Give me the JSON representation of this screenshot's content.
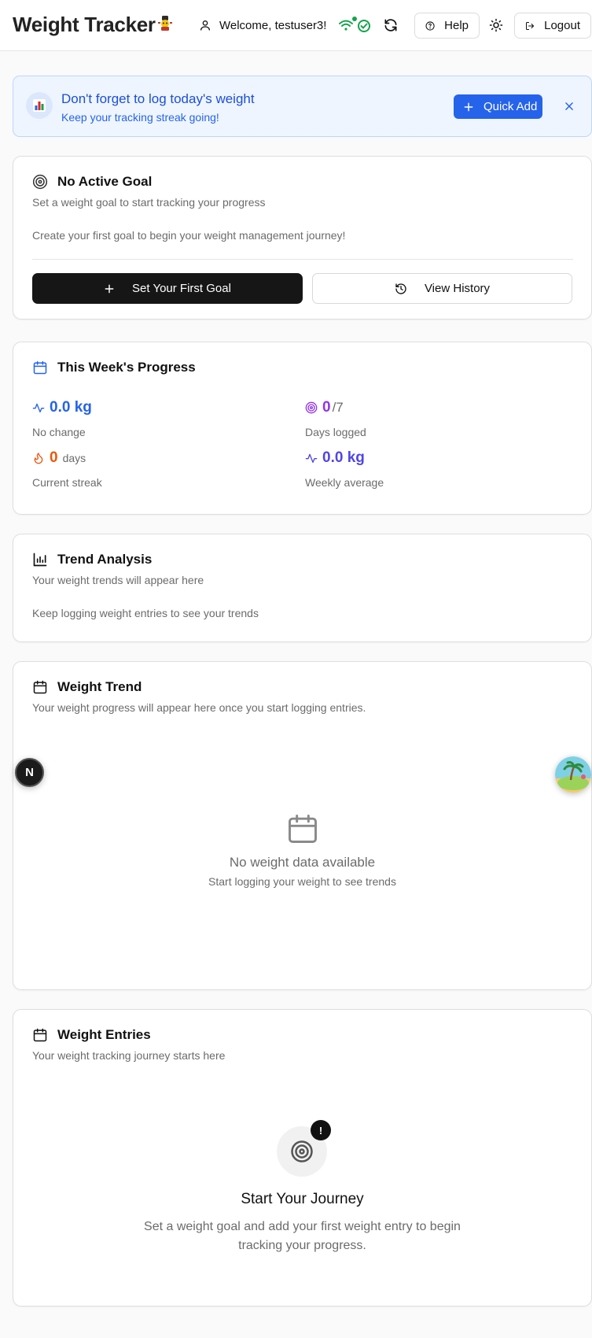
{
  "header": {
    "title": "Weight Tracker",
    "welcome": "Welcome, testuser3!",
    "help_label": "Help",
    "logout_label": "Logout"
  },
  "banner": {
    "title": "Don't forget to log today's weight",
    "subtitle": "Keep your tracking streak going!",
    "quick_add_label": "Quick Add"
  },
  "goal": {
    "title": "No Active Goal",
    "subtitle": "Set a weight goal to start tracking your progress",
    "message": "Create your first goal to begin your weight management journey!",
    "primary_label": "Set Your First Goal",
    "secondary_label": "View History"
  },
  "progress": {
    "title": "This Week's Progress",
    "change_value": "0.0 kg",
    "change_label": "No change",
    "days_value": "0",
    "days_total": "/7",
    "days_label": "Days logged",
    "streak_value": "0",
    "streak_unit": "days",
    "streak_label": "Current streak",
    "avg_value": "0.0 kg",
    "avg_label": "Weekly average"
  },
  "trend_analysis": {
    "title": "Trend Analysis",
    "subtitle": "Your weight trends will appear here",
    "message": "Keep logging weight entries to see your trends"
  },
  "weight_trend": {
    "title": "Weight Trend",
    "subtitle": "Your weight progress will appear here once you start logging entries.",
    "empty_title": "No weight data available",
    "empty_sub": "Start logging your weight to see trends"
  },
  "entries": {
    "title": "Weight Entries",
    "subtitle": "Your weight tracking journey starts here",
    "empty_title": "Start Your Journey",
    "empty_sub_line1": "Set a weight goal and add your first weight entry to begin",
    "empty_sub_line2": "tracking your progress.",
    "badge": "!"
  },
  "floating": {
    "n_label": "N"
  },
  "colors": {
    "accent_blue": "#2563eb",
    "purple": "#9333ea",
    "orange": "#ea580c",
    "indigo": "#4f46e5",
    "online_green": "#16a34a"
  }
}
